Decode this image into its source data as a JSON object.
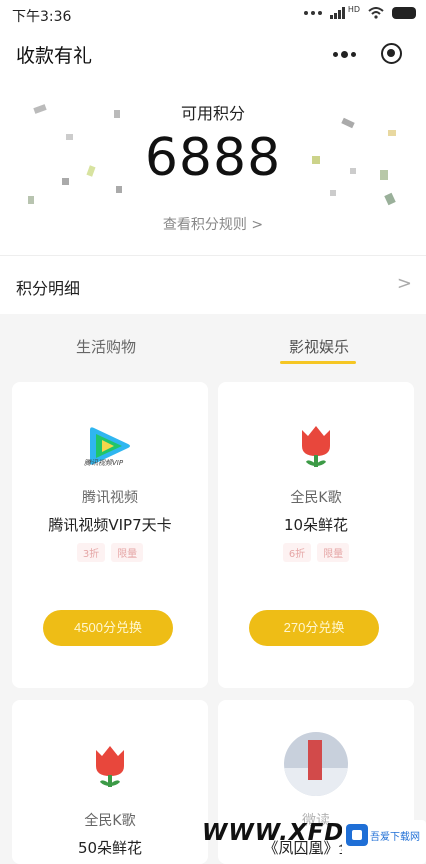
{
  "status_bar": {
    "time": "下午3:36",
    "network_label": "HD"
  },
  "nav": {
    "title": "收款有礼"
  },
  "points": {
    "label": "可用积分",
    "value": "6888",
    "rules_link": "查看积分规则 >"
  },
  "detail": {
    "label": "积分明细",
    "chevron": ">"
  },
  "tabs": [
    {
      "label": "生活购物",
      "active": false
    },
    {
      "label": "影视娱乐",
      "active": true
    }
  ],
  "products": [
    {
      "brand": "腾讯视频",
      "title": "腾讯视频VIP7天卡",
      "tags": [
        "3折",
        "限量"
      ],
      "button": "4500分兑换",
      "logo_caption": "腾讯视频VIP"
    },
    {
      "brand": "全民K歌",
      "title": "10朵鲜花",
      "tags": [
        "6折",
        "限量"
      ],
      "button": "270分兑换"
    },
    {
      "brand": "全民K歌",
      "title": "50朵鲜花"
    },
    {
      "brand": "微读",
      "title": "《凤囚凰》全本"
    }
  ],
  "watermark": {
    "text": "WWW.XFDOW",
    "badge": "吾爱下载网"
  },
  "colors": {
    "accent": "#eebd16",
    "tag_bg": "#fdeeee",
    "tag_text": "#d88888",
    "page_bg": "#f5f5f5"
  }
}
